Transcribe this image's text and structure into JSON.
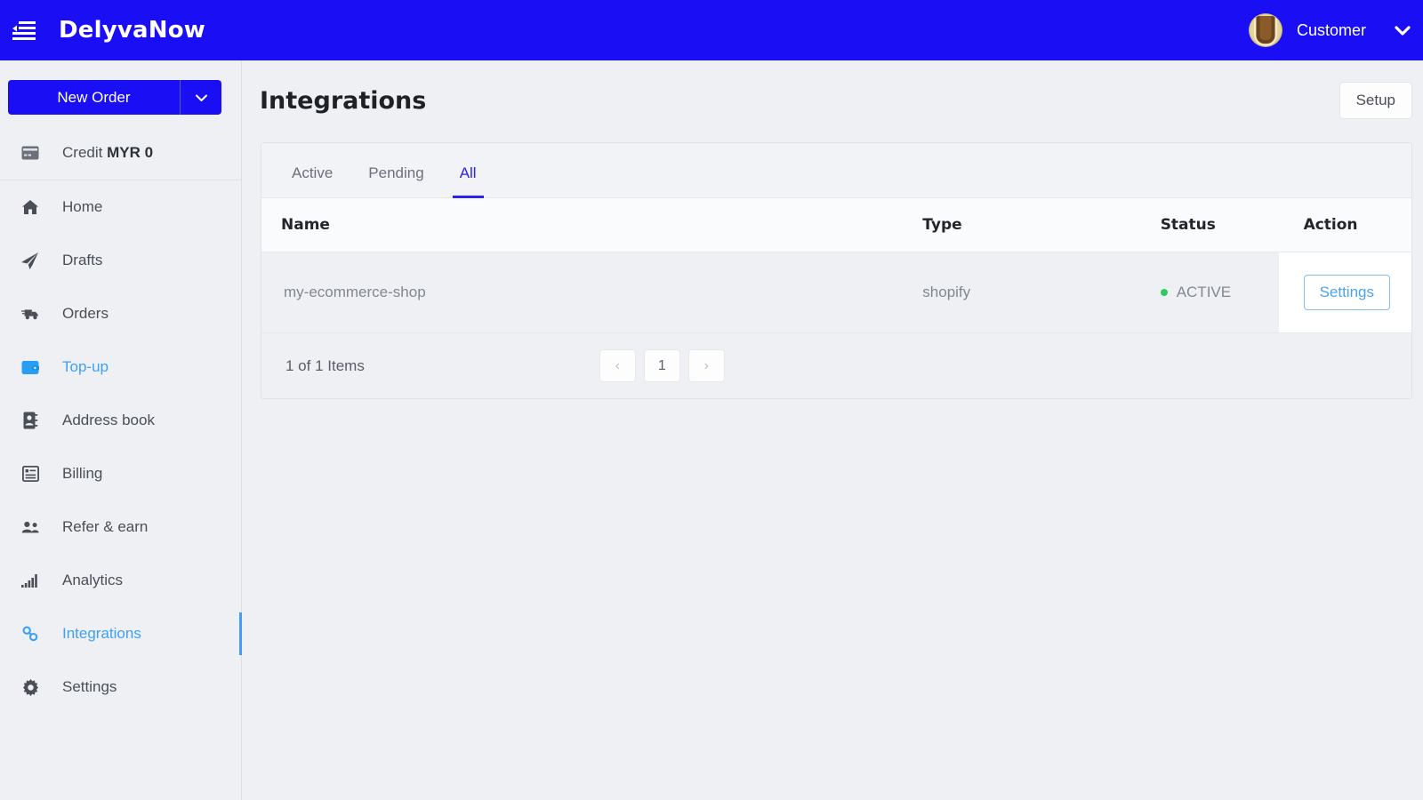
{
  "topbar": {
    "menu_icon": "menu-collapse-icon",
    "brand": "DelyvaNow",
    "username": "Customer",
    "caret_icon": "chevron-down-icon",
    "bg_color": "#1a0ef5"
  },
  "sidebar": {
    "new_order_label": "New Order",
    "new_order_caret_icon": "chevron-down-icon",
    "credit": {
      "icon": "credit-card-icon",
      "label": "Credit ",
      "value": "MYR 0"
    },
    "items": [
      {
        "label": "Home",
        "icon": "home-icon",
        "active": false
      },
      {
        "label": "Drafts",
        "icon": "paper-plane-icon",
        "active": false
      },
      {
        "label": "Orders",
        "icon": "truck-icon",
        "active": false
      },
      {
        "label": "Top-up",
        "icon": "wallet-icon",
        "active": false,
        "highlight": true
      },
      {
        "label": "Address book",
        "icon": "address-book-icon",
        "active": false
      },
      {
        "label": "Billing",
        "icon": "invoice-list-icon",
        "active": false
      },
      {
        "label": "Refer & earn",
        "icon": "people-icon",
        "active": false
      },
      {
        "label": "Analytics",
        "icon": "bar-chart-icon",
        "active": false
      },
      {
        "label": "Integrations",
        "icon": "link-chain-icon",
        "active": true
      },
      {
        "label": "Settings",
        "icon": "gear-icon",
        "active": false
      }
    ],
    "accent_color": "#3fa0f3"
  },
  "main": {
    "title": "Integrations",
    "setup_label": "Setup",
    "tabs": [
      {
        "label": "Active",
        "active": false
      },
      {
        "label": "Pending",
        "active": false
      },
      {
        "label": "All",
        "active": true
      }
    ],
    "table": {
      "headers": [
        "Name",
        "Type",
        "Status",
        "Action"
      ],
      "rows": [
        {
          "name": "my-ecommerce-shop",
          "type": "shopify",
          "status": "ACTIVE",
          "status_color": "#2ecc5f",
          "action_label": "Settings"
        }
      ]
    },
    "footer": {
      "items_count": "1 of 1 Items",
      "prev_label": "‹",
      "page_label": "1",
      "next_label": "›"
    }
  }
}
